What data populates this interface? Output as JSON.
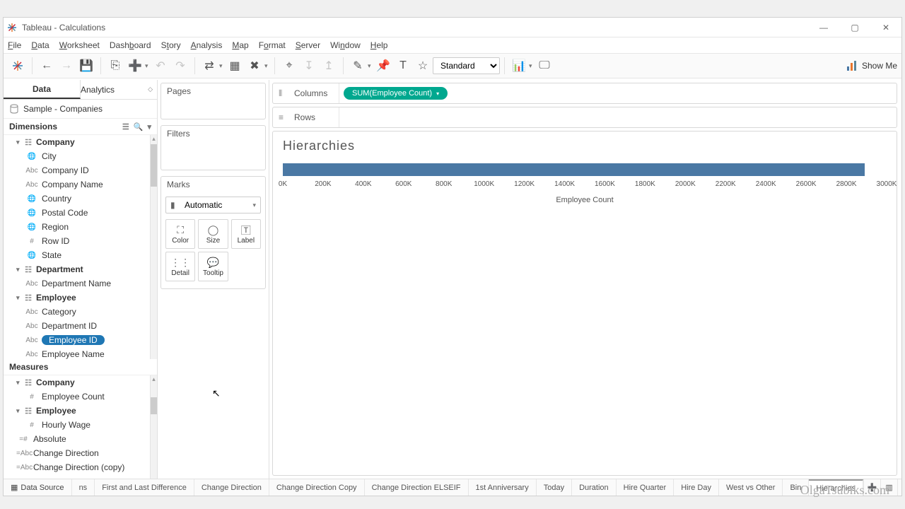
{
  "titlebar": {
    "title": "Tableau - Calculations"
  },
  "menubar": [
    "File",
    "Data",
    "Worksheet",
    "Dashboard",
    "Story",
    "Analysis",
    "Map",
    "Format",
    "Server",
    "Window",
    "Help"
  ],
  "toolbar": {
    "fit": "Standard",
    "show_me": "Show Me"
  },
  "data_tabs": {
    "data": "Data",
    "analytics": "Analytics"
  },
  "datasource": "Sample - Companies",
  "dimensions_label": "Dimensions",
  "measures_label": "Measures",
  "dim_tree": {
    "company": {
      "label": "Company",
      "children": [
        {
          "icon": "globe",
          "label": "City"
        },
        {
          "icon": "abc",
          "label": "Company ID"
        },
        {
          "icon": "abc",
          "label": "Company Name"
        },
        {
          "icon": "globe",
          "label": "Country"
        },
        {
          "icon": "globe",
          "label": "Postal Code"
        },
        {
          "icon": "globe",
          "label": "Region"
        },
        {
          "icon": "hash",
          "label": "Row ID"
        },
        {
          "icon": "globe",
          "label": "State"
        }
      ]
    },
    "department": {
      "label": "Department",
      "children": [
        {
          "icon": "abc",
          "label": "Department Name"
        }
      ]
    },
    "employee": {
      "label": "Employee",
      "children": [
        {
          "icon": "abc",
          "label": "Category"
        },
        {
          "icon": "abc",
          "label": "Department ID"
        },
        {
          "icon": "abc",
          "label": "Employee ID",
          "selected": true
        },
        {
          "icon": "abc",
          "label": "Employee Name"
        }
      ]
    }
  },
  "meas_tree": {
    "company": {
      "label": "Company",
      "children": [
        {
          "icon": "hash",
          "label": "Employee Count"
        }
      ]
    },
    "employee": {
      "label": "Employee",
      "children": [
        {
          "icon": "hash",
          "label": "Hourly Wage"
        }
      ]
    },
    "flat": [
      {
        "icon": "eqhash",
        "label": "Absolute"
      },
      {
        "icon": "eqabc",
        "label": "Change Direction"
      },
      {
        "icon": "eqabc",
        "label": "Change Direction (copy)"
      }
    ]
  },
  "shelves": {
    "pages": "Pages",
    "filters": "Filters",
    "marks": "Marks",
    "marks_type": "Automatic",
    "mark_cells": [
      "Color",
      "Size",
      "Label"
    ],
    "mark_cells2": [
      "Detail",
      "Tooltip"
    ]
  },
  "columns_label": "Columns",
  "rows_label": "Rows",
  "columns_pill": "SUM(Employee Count)",
  "viz": {
    "title": "Hierarchies",
    "axis_label": "Employee Count",
    "ticks": [
      "0K",
      "200K",
      "400K",
      "600K",
      "800K",
      "1000K",
      "1200K",
      "1400K",
      "1600K",
      "1800K",
      "2000K",
      "2200K",
      "2400K",
      "2600K",
      "2800K",
      "3000K"
    ],
    "axis_max": 3000,
    "bar_value": 2890
  },
  "sheet_tabs": {
    "data_source": "Data Source",
    "partial": "ns",
    "tabs": [
      "First and Last Difference",
      "Change Direction",
      "Change Direction Copy",
      "Change Direction ELSEIF",
      "1st Anniversary",
      "Today",
      "Duration",
      "Hire Quarter",
      "Hire Day",
      "West vs Other",
      "Bin",
      "Hierarchies"
    ],
    "active": "Hierarchies"
  },
  "watermark": "OlgaTsubiks.com",
  "chart_data": {
    "type": "bar",
    "title": "Hierarchies",
    "xlabel": "Employee Count",
    "ylabel": "",
    "categories": [
      ""
    ],
    "values": [
      2890000
    ],
    "xlim": [
      0,
      3000000
    ]
  }
}
